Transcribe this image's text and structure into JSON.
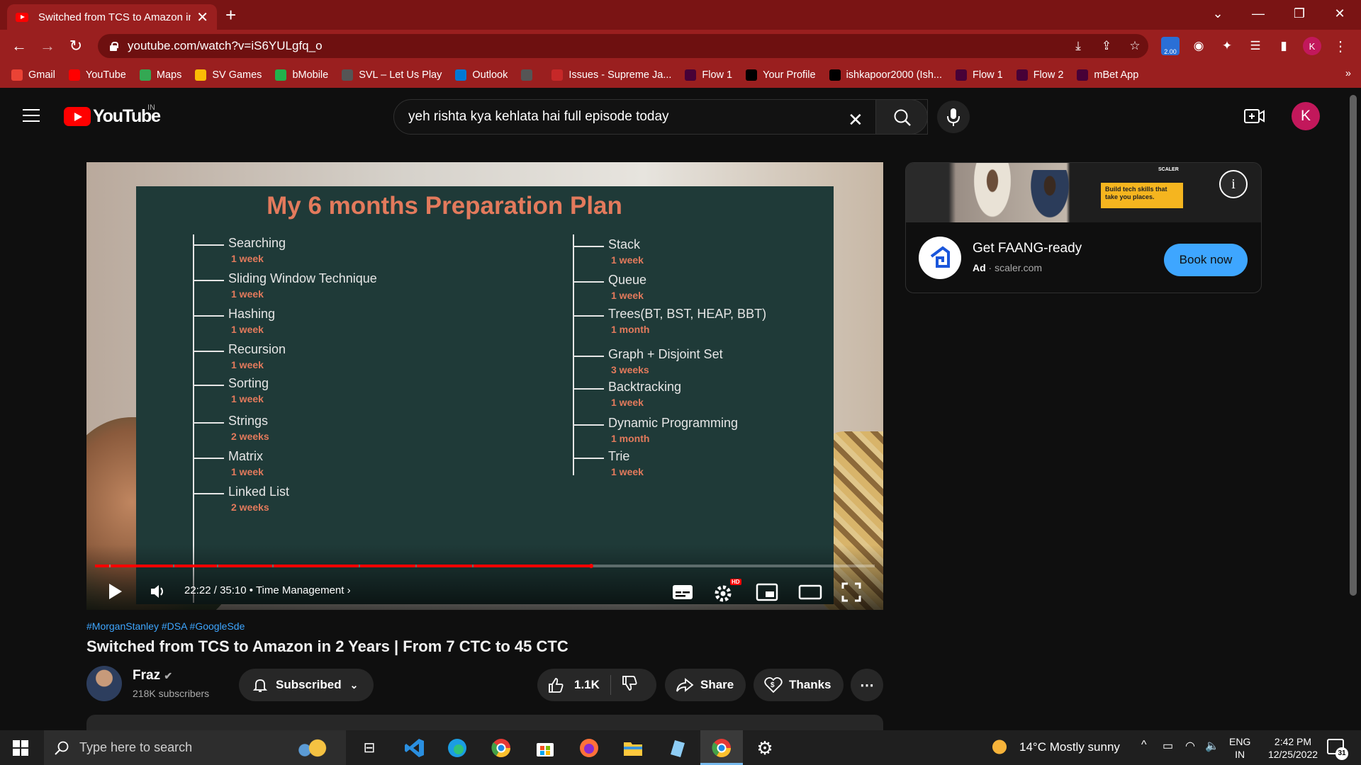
{
  "browser": {
    "tab_title": "Switched from TCS to Amazon in 2 Years | From 7 CTC to 45 CTC",
    "tab_close": "✕",
    "new_tab": "+",
    "url": "youtube.com/watch?v=iS6YULgfq_o",
    "extension_badge": "2.00",
    "profile_initial": "K",
    "window_controls": {
      "chevron": "⌄",
      "minimize": "—",
      "restore": "❐",
      "close": "✕"
    },
    "bookmarks": [
      {
        "label": "Gmail",
        "icon": "gmail-icon",
        "color": "#ea4335"
      },
      {
        "label": "YouTube",
        "icon": "youtube-icon",
        "color": "#ff0000"
      },
      {
        "label": "Maps",
        "icon": "maps-icon",
        "color": "#34a853"
      },
      {
        "label": "SV Games",
        "icon": "games-icon",
        "color": "#fbbc05"
      },
      {
        "label": "bMobile",
        "icon": "bmobile-icon",
        "color": "#22b14c"
      },
      {
        "label": "SVL – Let Us Play",
        "icon": "globe-icon",
        "color": "#555555"
      },
      {
        "label": "Outlook",
        "icon": "outlook-icon",
        "color": "#0078d4"
      },
      {
        "label": "",
        "icon": "globe-icon",
        "color": "#555555"
      },
      {
        "label": "Issues - Supreme Ja...",
        "icon": "issues-icon",
        "color": "#c62828"
      },
      {
        "label": "Flow 1",
        "icon": "xd-icon",
        "color": "#470137"
      },
      {
        "label": "Your Profile",
        "icon": "github-icon",
        "color": "#000000"
      },
      {
        "label": "ishkapoor2000 (Ish...",
        "icon": "github-icon",
        "color": "#000000"
      },
      {
        "label": "Flow 1",
        "icon": "xd-icon",
        "color": "#470137"
      },
      {
        "label": "Flow 2",
        "icon": "xd-icon",
        "color": "#470137"
      },
      {
        "label": "mBet App",
        "icon": "xd-icon",
        "color": "#470137"
      }
    ],
    "bookmarks_more": "»"
  },
  "youtube": {
    "logo_text": "YouTube",
    "country_code": "IN",
    "search_value": "yeh rishta kya kehlata hai full episode today",
    "avatar_initial": "K"
  },
  "player": {
    "slide_title": "My 6 months Preparation Plan",
    "left_topics": [
      {
        "label": "Searching",
        "duration": "1 week"
      },
      {
        "label": "Sliding Window Technique",
        "duration": "1 week"
      },
      {
        "label": "Hashing",
        "duration": "1 week"
      },
      {
        "label": "Recursion",
        "duration": "1 week"
      },
      {
        "label": "Sorting",
        "duration": "1 week"
      },
      {
        "label": "Strings",
        "duration": "2 weeks"
      },
      {
        "label": "Matrix",
        "duration": "1 week"
      },
      {
        "label": "Linked List",
        "duration": "2 weeks"
      }
    ],
    "right_topics": [
      {
        "label": "Stack",
        "duration": "1 week"
      },
      {
        "label": "Queue",
        "duration": "1 week"
      },
      {
        "label": "Trees(BT, BST, HEAP, BBT)",
        "duration": "1 month"
      },
      {
        "label": "Graph + Disjoint Set",
        "duration": "3 weeks"
      },
      {
        "label": "Backtracking",
        "duration": "1 week"
      },
      {
        "label": "Dynamic Programming",
        "duration": "1 month"
      },
      {
        "label": "Trie",
        "duration": "1 week"
      }
    ],
    "current_time": "22:22",
    "duration": "35:10",
    "separator": "/",
    "chapter": "Time Management",
    "hd_badge": "HD",
    "progress_fraction": 0.636
  },
  "ad": {
    "banner_text": "Build tech skills that take you places.",
    "brand_mark": "SCALER",
    "title": "Get FAANG-ready",
    "ad_label": "Ad",
    "domain": "scaler.com",
    "cta": "Book now"
  },
  "video": {
    "hashtags": "#MorganStanley #DSA #GoogleSde",
    "title": "Switched from TCS to Amazon in 2 Years | From 7 CTC to 45 CTC",
    "channel": "Fraz",
    "subscribers": "218K subscribers",
    "subscribed_label": "Subscribed",
    "likes": "1.1K",
    "share_label": "Share",
    "thanks_label": "Thanks",
    "more": "⋯"
  },
  "taskbar": {
    "search_placeholder": "Type here to search",
    "weather": "14°C  Mostly sunny",
    "lang_top": "ENG",
    "lang_bottom": "IN",
    "time": "2:42 PM",
    "date": "12/25/2022",
    "notif_count": "31"
  }
}
